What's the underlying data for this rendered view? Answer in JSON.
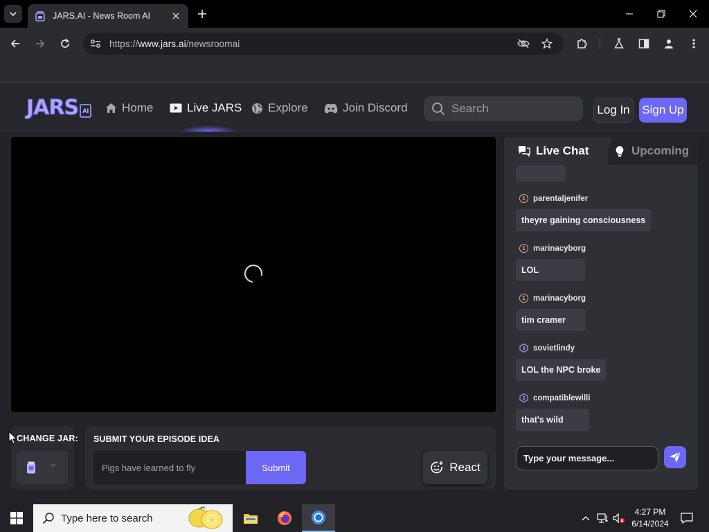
{
  "browser": {
    "tab_title": "JARS.AI - News Room AI",
    "url_prefix": "https://",
    "url_host": "www.jars.ai",
    "url_path": "/newsroomai"
  },
  "site": {
    "logo_text": "JARS",
    "logo_badge": "AI",
    "nav": [
      {
        "label": "Home",
        "icon": "home-icon"
      },
      {
        "label": "Live JARS",
        "icon": "live-video-icon"
      },
      {
        "label": "Explore",
        "icon": "globe-icon"
      },
      {
        "label": "Join Discord",
        "icon": "discord-icon"
      }
    ],
    "search_placeholder": "Search",
    "login_label": "Log In",
    "signup_label": "Sign Up",
    "accent_color": "#6d67f5"
  },
  "controls": {
    "change_jar_label": "CHANGE JAR:",
    "episode_label": "SUBMIT YOUR EPISODE IDEA",
    "episode_placeholder": "Pigs have learned to fly",
    "submit_label": "Submit",
    "react_label": "React"
  },
  "chat": {
    "tab_live": "Live Chat",
    "tab_upcoming": "Upcoming",
    "input_placeholder": "Type your message...",
    "messages": [
      {
        "level": "1",
        "user": "parentaljenifer",
        "text": "theyre gaining consciousness"
      },
      {
        "level": "1",
        "user": "marinacyborg",
        "text": "LOL"
      },
      {
        "level": "1",
        "user": "marinacyborg",
        "text": "tim cramer"
      },
      {
        "level": "3",
        "user": "sovietlindy",
        "text": "LOL the NPC broke"
      },
      {
        "level": "3",
        "user": "compatiblewilli",
        "text": "that's wild"
      }
    ]
  },
  "taskbar": {
    "search_text": "Type here to search",
    "time": "4:27 PM",
    "date": "6/14/2024"
  }
}
